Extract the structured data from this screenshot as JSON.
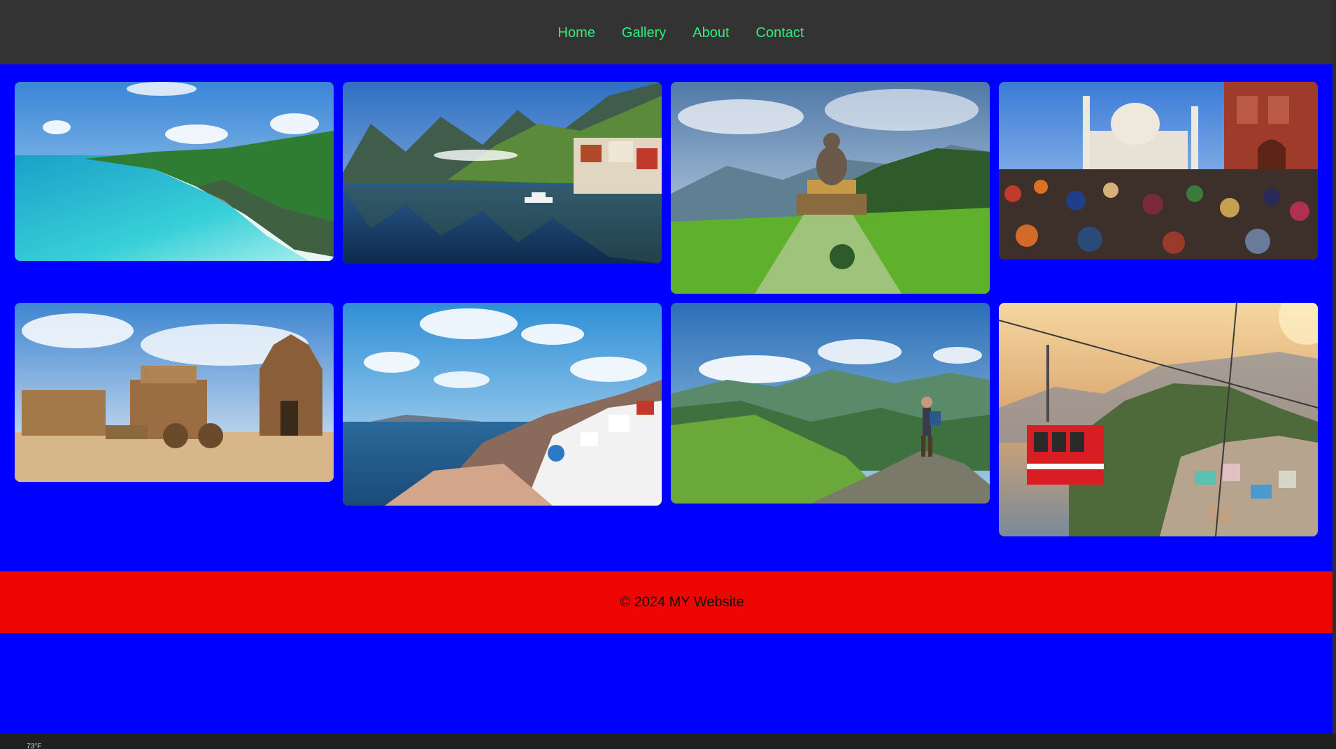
{
  "nav": {
    "items": [
      {
        "label": "Home"
      },
      {
        "label": "Gallery"
      },
      {
        "label": "About"
      },
      {
        "label": "Contact"
      }
    ],
    "link_color": "#33ee77",
    "background": "#333333"
  },
  "gallery": {
    "images": [
      {
        "subject": "tropical beach with palm trees"
      },
      {
        "subject": "lakeside alpine village with boat"
      },
      {
        "subject": "buddha statue on green hillside"
      },
      {
        "subject": "crowd in front of taj mahal"
      },
      {
        "subject": "ancient stone temple chariot"
      },
      {
        "subject": "white cliffside village by sea"
      },
      {
        "subject": "hiker on green mountain ridge"
      },
      {
        "subject": "red cable car over hill town"
      }
    ]
  },
  "footer": {
    "text": "© 2024 MY Website",
    "background": "#f00505"
  },
  "taskbar": {
    "weather": "73°F"
  },
  "colors": {
    "page_background": "#0000ff"
  }
}
